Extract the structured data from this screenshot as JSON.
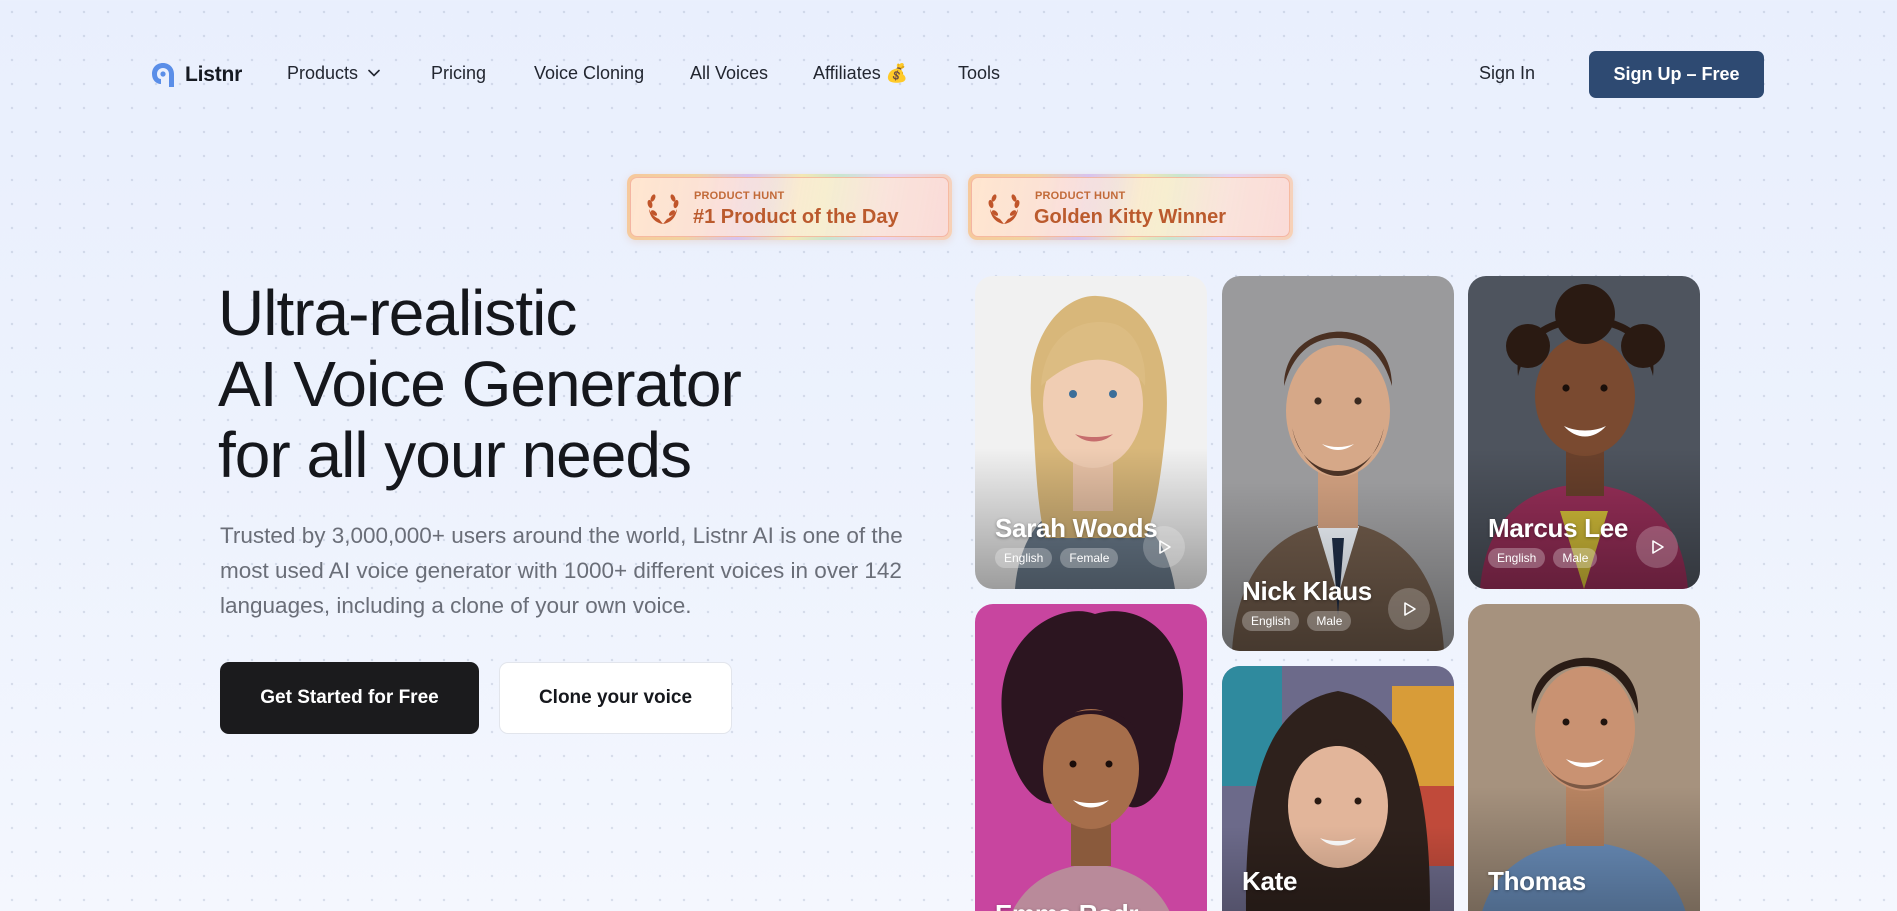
{
  "nav": {
    "logo_text": "Listnr",
    "items": [
      {
        "label": "Products",
        "has_dropdown": true
      },
      {
        "label": "Pricing"
      },
      {
        "label": "Voice Cloning"
      },
      {
        "label": "All Voices"
      },
      {
        "label": "Affiliates 💰"
      },
      {
        "label": "Tools"
      }
    ],
    "sign_in": "Sign In",
    "sign_up": "Sign Up – Free"
  },
  "badges": [
    {
      "kicker": "PRODUCT HUNT",
      "title": "#1 Product of the Day"
    },
    {
      "kicker": "PRODUCT HUNT",
      "title": "Golden Kitty Winner"
    }
  ],
  "hero": {
    "title_lines": [
      "Ultra-realistic",
      "AI Voice Generator",
      "for all your needs"
    ],
    "subtitle": "Trusted by 3,000,000+ users around the world, Listnr AI is one of the most used AI voice generator with 1000+ different voices in over 142 languages, including a clone of your own voice.",
    "primary_cta": "Get Started for Free",
    "secondary_cta": "Clone your voice"
  },
  "voices": [
    {
      "name": "Sarah Woods",
      "tags": [
        "English",
        "Female"
      ]
    },
    {
      "name": "Nick Klaus",
      "tags": [
        "English",
        "Male"
      ]
    },
    {
      "name": "Marcus Lee",
      "tags": [
        "English",
        "Male"
      ]
    },
    {
      "name": "Emma Rodr",
      "tags": []
    },
    {
      "name": "Kate",
      "tags": []
    },
    {
      "name": "Thomas",
      "tags": []
    }
  ],
  "colors": {
    "accent": "#2e4a72",
    "primary_button": "#1b1b1d",
    "badge_text": "#bb5a2d"
  },
  "icons": {
    "logo": "listnr-logo-icon",
    "dropdown": "chevron-down-icon",
    "laurel": "laurel-icon",
    "play": "play-icon"
  }
}
